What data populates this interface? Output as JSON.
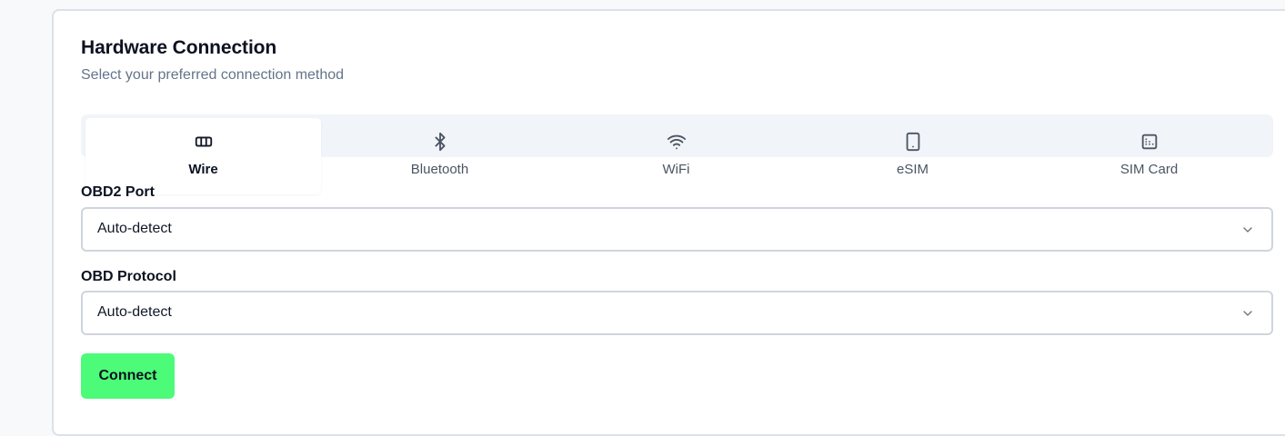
{
  "header": {
    "title": "Hardware Connection",
    "subtitle": "Select your preferred connection method"
  },
  "tabs": [
    {
      "label": "Wire",
      "icon": "cable-icon",
      "active": true
    },
    {
      "label": "Bluetooth",
      "icon": "bluetooth-icon",
      "active": false
    },
    {
      "label": "WiFi",
      "icon": "wifi-icon",
      "active": false
    },
    {
      "label": "eSIM",
      "icon": "smartphone-icon",
      "active": false
    },
    {
      "label": "SIM Card",
      "icon": "sim-card-icon",
      "active": false
    }
  ],
  "fields": {
    "port": {
      "label": "OBD2 Port",
      "value": "Auto-detect"
    },
    "protocol": {
      "label": "OBD Protocol",
      "value": "Auto-detect"
    }
  },
  "actions": {
    "connect_label": "Connect"
  },
  "colors": {
    "accent": "#4cfb78",
    "muted_text": "#64748b",
    "border": "#cfd5dd"
  }
}
